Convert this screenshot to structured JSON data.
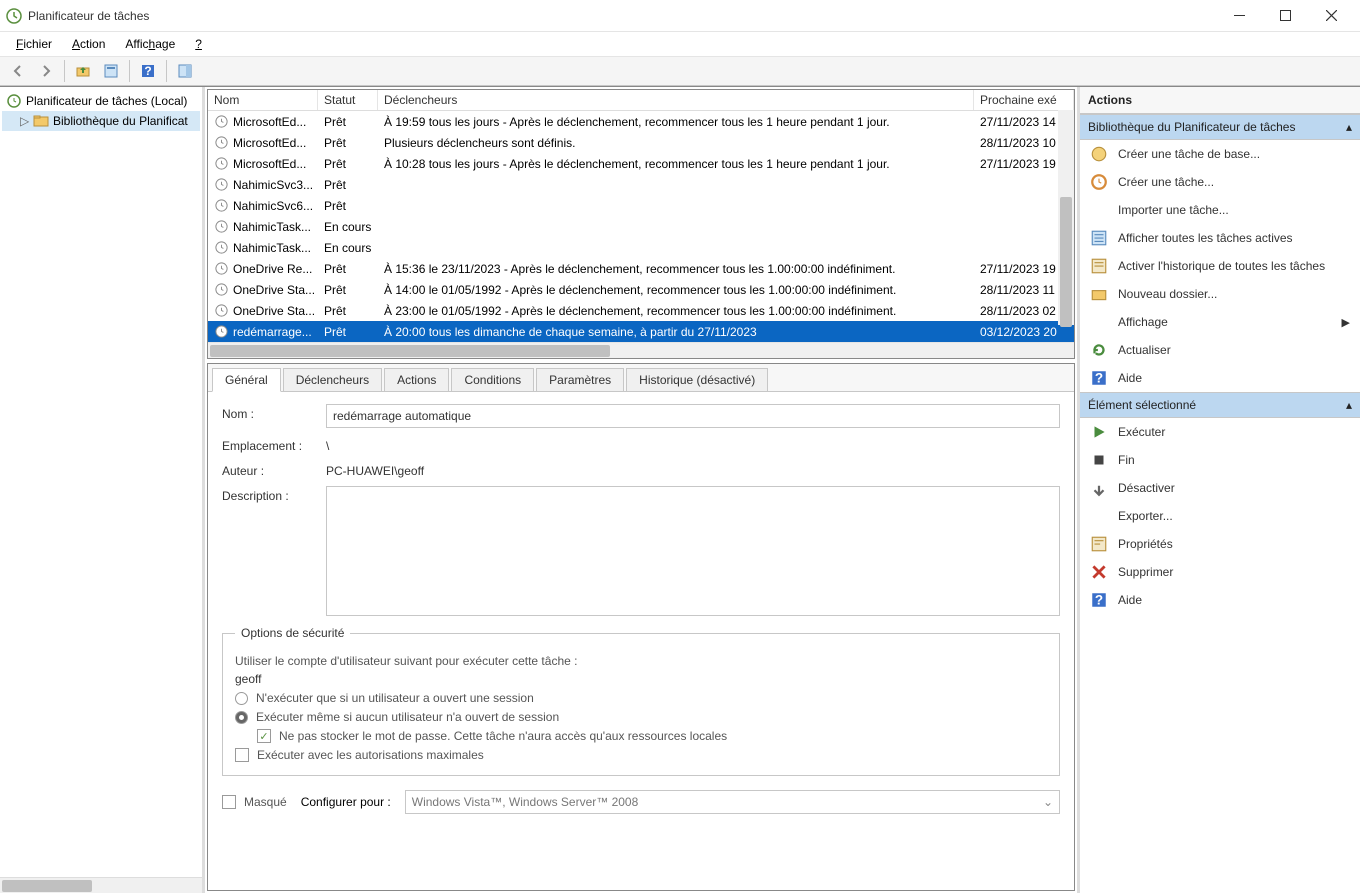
{
  "window": {
    "title": "Planificateur de tâches"
  },
  "menubar": {
    "file": "Fichier",
    "action": "Action",
    "view": "Affichage",
    "help": "?"
  },
  "tree": {
    "root": "Planificateur de tâches (Local)",
    "child": "Bibliothèque du Planificat"
  },
  "grid": {
    "headers": {
      "name": "Nom",
      "status": "Statut",
      "triggers": "Déclencheurs",
      "next": "Prochaine exé"
    },
    "rows": [
      {
        "name": "MicrosoftEd...",
        "status": "Prêt",
        "trigger": "À 19:59 tous les jours - Après le déclenchement, recommencer tous les 1 heure pendant 1 jour.",
        "next": "27/11/2023 14"
      },
      {
        "name": "MicrosoftEd...",
        "status": "Prêt",
        "trigger": "Plusieurs déclencheurs sont définis.",
        "next": "28/11/2023 10"
      },
      {
        "name": "MicrosoftEd...",
        "status": "Prêt",
        "trigger": "À 10:28 tous les jours - Après le déclenchement, recommencer tous les 1 heure pendant 1 jour.",
        "next": "27/11/2023 19"
      },
      {
        "name": "NahimicSvc3...",
        "status": "Prêt",
        "trigger": "",
        "next": ""
      },
      {
        "name": "NahimicSvc6...",
        "status": "Prêt",
        "trigger": "",
        "next": ""
      },
      {
        "name": "NahimicTask...",
        "status": "En cours",
        "trigger": "",
        "next": ""
      },
      {
        "name": "NahimicTask...",
        "status": "En cours",
        "trigger": "",
        "next": ""
      },
      {
        "name": "OneDrive Re...",
        "status": "Prêt",
        "trigger": "À 15:36 le 23/11/2023 - Après le déclenchement, recommencer tous les 1.00:00:00 indéfiniment.",
        "next": "27/11/2023 19"
      },
      {
        "name": "OneDrive Sta...",
        "status": "Prêt",
        "trigger": "À 14:00 le 01/05/1992 - Après le déclenchement, recommencer tous les 1.00:00:00 indéfiniment.",
        "next": "28/11/2023 11"
      },
      {
        "name": "OneDrive Sta...",
        "status": "Prêt",
        "trigger": "À 23:00 le 01/05/1992 - Après le déclenchement, recommencer tous les 1.00:00:00 indéfiniment.",
        "next": "28/11/2023 02"
      },
      {
        "name": "redémarrage...",
        "status": "Prêt",
        "trigger": "À 20:00 tous les dimanche de chaque semaine, à partir du 27/11/2023",
        "next": "03/12/2023 20",
        "selected": true
      }
    ]
  },
  "tabs": {
    "general": "Général",
    "triggers": "Déclencheurs",
    "actions": "Actions",
    "conditions": "Conditions",
    "params": "Paramètres",
    "history": "Historique (désactivé)"
  },
  "details": {
    "labels": {
      "name": "Nom :",
      "location": "Emplacement :",
      "author": "Auteur :",
      "description": "Description :"
    },
    "values": {
      "name": "redémarrage automatique",
      "location": "\\",
      "author": "PC-HUAWEI\\geoff",
      "description": ""
    },
    "security": {
      "legend": "Options de sécurité",
      "useAccountText": "Utiliser le compte d'utilisateur suivant pour exécuter cette tâche :",
      "account": "geoff",
      "runOnlyLoggedOn": "N'exécuter que si un utilisateur a ouvert une session",
      "runWhetherLoggedOn": "Exécuter même si aucun utilisateur n'a ouvert de session",
      "dontStorePassword": "Ne pas stocker le mot de passe. Cette tâche n'aura accès qu'aux ressources locales",
      "highestPriv": "Exécuter avec les autorisations maximales"
    },
    "hidden": "Masqué",
    "configureFor": "Configurer pour :",
    "configureValue": "Windows Vista™, Windows Server™ 2008"
  },
  "actions": {
    "header": "Actions",
    "librarySection": "Bibliothèque du Planificateur de tâches",
    "libraryItems": {
      "createBasic": "Créer une tâche de base...",
      "create": "Créer une tâche...",
      "import": "Importer une tâche...",
      "showAll": "Afficher toutes les tâches actives",
      "enableHistory": "Activer l'historique de toutes les tâches",
      "newFolder": "Nouveau dossier...",
      "view": "Affichage",
      "refresh": "Actualiser",
      "help": "Aide"
    },
    "selectedSection": "Élément sélectionné",
    "selectedItems": {
      "run": "Exécuter",
      "end": "Fin",
      "disable": "Désactiver",
      "export": "Exporter...",
      "properties": "Propriétés",
      "delete": "Supprimer",
      "help": "Aide"
    }
  }
}
